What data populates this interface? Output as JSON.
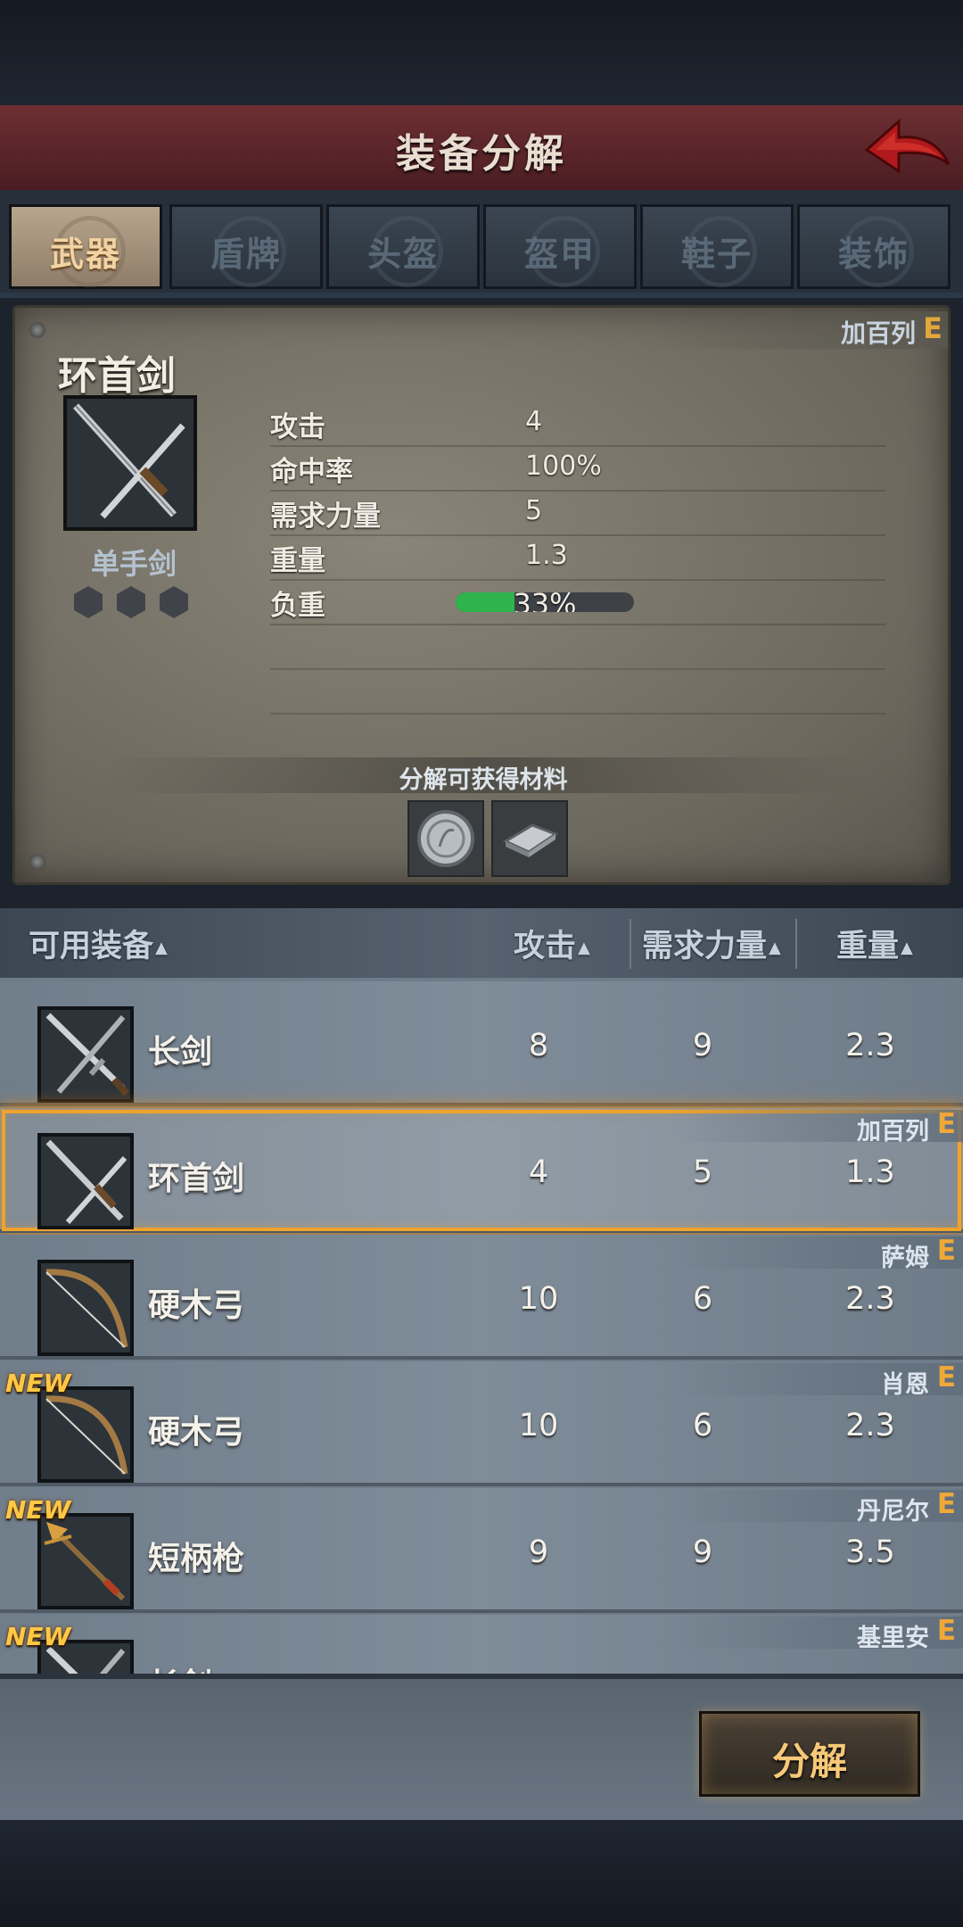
{
  "header": {
    "title": "装备分解"
  },
  "tabs": [
    {
      "label": "武器",
      "active": true
    },
    {
      "label": "盾牌",
      "active": false
    },
    {
      "label": "头盔",
      "active": false
    },
    {
      "label": "盔甲",
      "active": false
    },
    {
      "label": "鞋子",
      "active": false
    },
    {
      "label": "装饰",
      "active": false
    }
  ],
  "detail": {
    "owner": "加百列",
    "owner_rank": "E",
    "item_name": "环首剑",
    "item_type": "单手剑",
    "stats": [
      {
        "label": "攻击",
        "value": "4"
      },
      {
        "label": "命中率",
        "value": "100%"
      },
      {
        "label": "需求力量",
        "value": "5"
      },
      {
        "label": "重量",
        "value": "1.3"
      },
      {
        "label": "负重",
        "value": ""
      }
    ],
    "load_percent_text": "33%",
    "load_fraction": 0.33,
    "materials_title": "分解可获得材料",
    "materials": [
      "silver-coin-icon",
      "iron-ingot-icon"
    ]
  },
  "list_header": {
    "col_name": "可用装备",
    "col_attack": "攻击",
    "col_str": "需求力量",
    "col_weight": "重量",
    "sort_glyph": "▲"
  },
  "items": [
    {
      "name": "长剑",
      "attack": "8",
      "str": "9",
      "weight": "2.3",
      "owner": "",
      "rank": "",
      "new": false,
      "icon": "longsword-icon",
      "selected": false
    },
    {
      "name": "环首剑",
      "attack": "4",
      "str": "5",
      "weight": "1.3",
      "owner": "加百列",
      "rank": "E",
      "new": false,
      "icon": "ring-sword-icon",
      "selected": true
    },
    {
      "name": "硬木弓",
      "attack": "10",
      "str": "6",
      "weight": "2.3",
      "owner": "萨姆",
      "rank": "E",
      "new": false,
      "icon": "bow-icon",
      "selected": false
    },
    {
      "name": "硬木弓",
      "attack": "10",
      "str": "6",
      "weight": "2.3",
      "owner": "肖恩",
      "rank": "E",
      "new": true,
      "icon": "bow-icon",
      "selected": false
    },
    {
      "name": "短柄枪",
      "attack": "9",
      "str": "9",
      "weight": "3.5",
      "owner": "丹尼尔",
      "rank": "E",
      "new": true,
      "icon": "spear-icon",
      "selected": false
    },
    {
      "name": "长剑",
      "attack": "",
      "str": "",
      "weight": "",
      "owner": "基里安",
      "rank": "E",
      "new": true,
      "icon": "longsword-icon",
      "selected": false
    }
  ],
  "new_badge": "NEW",
  "actions": {
    "decompose": "分解"
  }
}
